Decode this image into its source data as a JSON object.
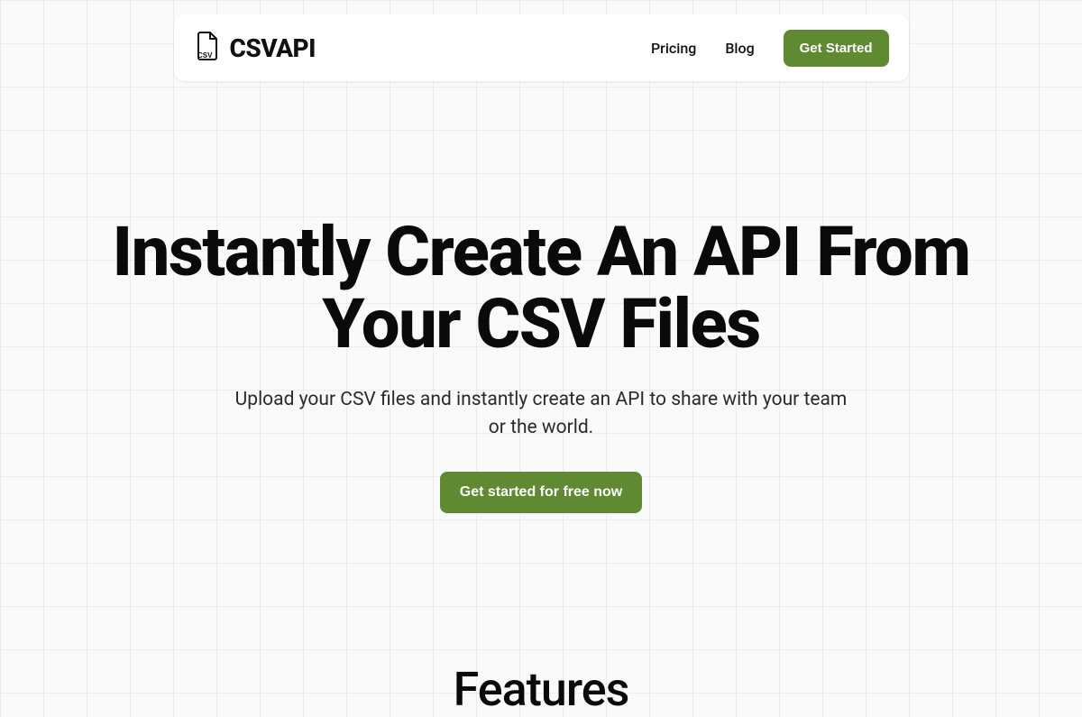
{
  "brand": {
    "name": "CSVAPI"
  },
  "nav": {
    "links": [
      {
        "label": "Pricing"
      },
      {
        "label": "Blog"
      }
    ],
    "cta": "Get Started"
  },
  "hero": {
    "title": "Instantly Create An API From Your CSV Files",
    "subtitle": "Upload your CSV files and instantly create an API to share with your team or the world.",
    "cta": "Get started for free now"
  },
  "features": {
    "heading": "Features"
  },
  "colors": {
    "primary": "#5f8a32"
  }
}
